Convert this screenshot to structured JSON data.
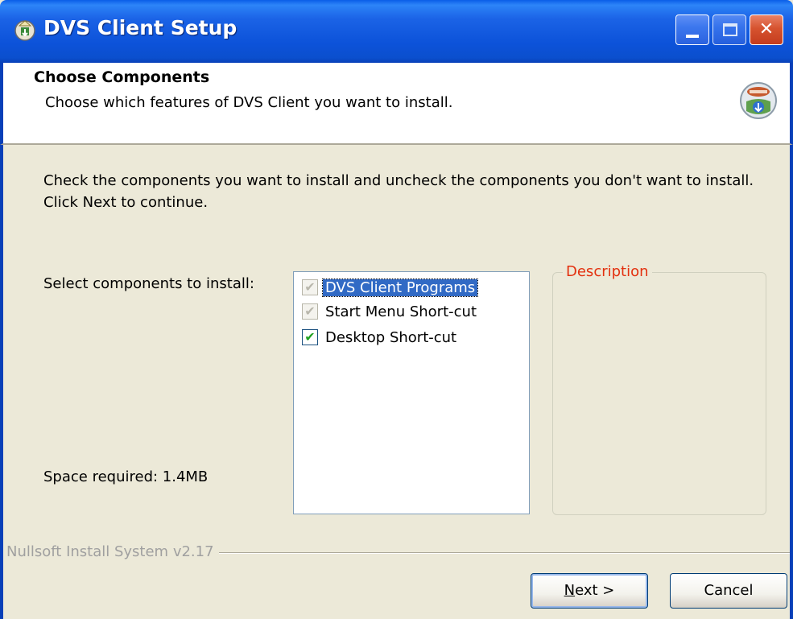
{
  "window": {
    "title": "DVS Client Setup"
  },
  "header": {
    "title": "Choose Components",
    "subtitle": "Choose which features of DVS Client you want to install."
  },
  "body": {
    "intro": "Check the components you want to install and uncheck the components you don't want to install. Click Next to continue.",
    "select_label": "Select components to install:",
    "space_required": "Space required: 1.4MB"
  },
  "components": [
    {
      "label": "DVS Client Programs",
      "checked": true,
      "disabled": true,
      "selected": true
    },
    {
      "label": "Start Menu Short-cut",
      "checked": true,
      "disabled": true,
      "selected": false
    },
    {
      "label": "Desktop Short-cut",
      "checked": true,
      "disabled": false,
      "selected": false
    }
  ],
  "description": {
    "legend": "Description"
  },
  "footer": {
    "branding": "Nullsoft Install System v2.17",
    "next_mnemonic": "N",
    "next_rest": "ext >",
    "cancel_label": "Cancel"
  },
  "colors": {
    "titlebar": "#0C52D9",
    "dialog_bg": "#ECE9D8",
    "selection": "#316AC5",
    "description_legend": "#E3300E"
  }
}
